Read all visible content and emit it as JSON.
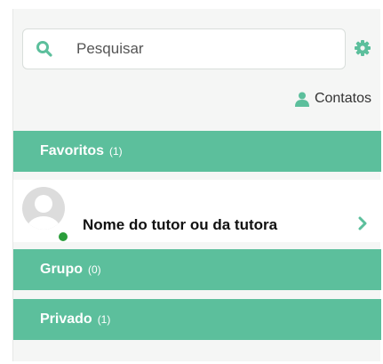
{
  "search": {
    "placeholder": "Pesquisar",
    "value": ""
  },
  "contacts_link": {
    "label": "Contatos"
  },
  "sections": {
    "favorites": {
      "label": "Favoritos",
      "count": "(1)"
    },
    "group": {
      "label": "Grupo",
      "count": "(0)"
    },
    "private": {
      "label": "Privado",
      "count": "(1)"
    }
  },
  "favorites_list": [
    {
      "name": "Nome do tutor ou da tutora",
      "status": "online"
    }
  ],
  "colors": {
    "accent": "#5cbf9c",
    "online": "#2a9d3a",
    "panel_bg": "#f5f6f5"
  },
  "icons": {
    "search": "search-icon",
    "settings": "gear-icon",
    "contacts": "person-icon",
    "open": "chevron-right-icon"
  }
}
